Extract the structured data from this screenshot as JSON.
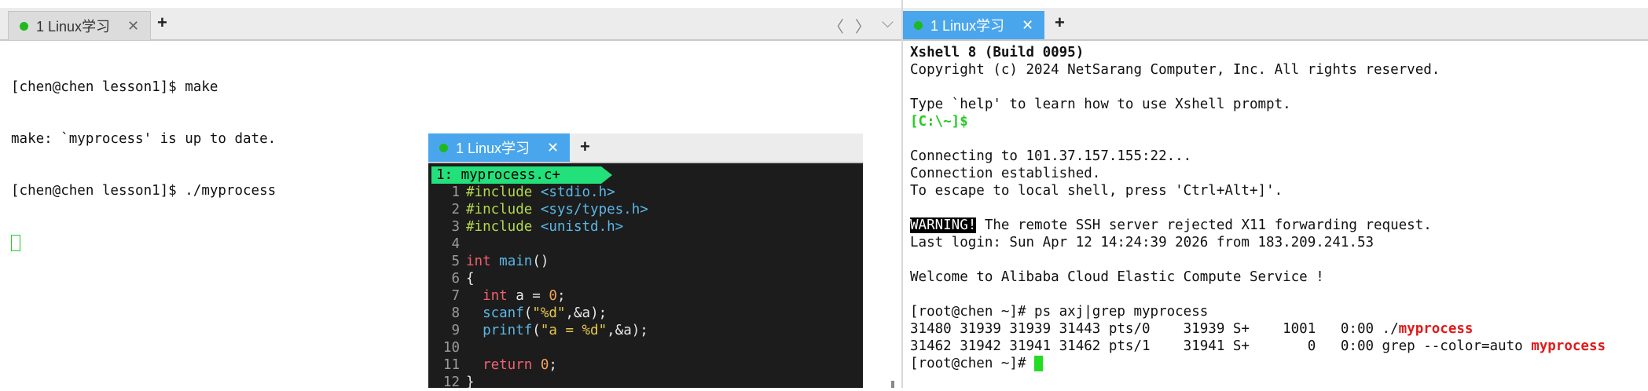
{
  "left": {
    "tab": {
      "label": "1 Linux学习",
      "close": "✕"
    },
    "plus": "+",
    "nav": {
      "prev": "〈",
      "next": "〉",
      "menu": "⌵"
    },
    "lines": [
      "[chen@chen lesson1]$ make",
      "make: `myprocess' is up to date.",
      "[chen@chen lesson1]$ ./myprocess"
    ]
  },
  "vim_window": {
    "tab": {
      "label": "1 Linux学习",
      "close": "✕"
    },
    "plus": "+",
    "buffer_title": "1: myprocess.c+",
    "code": [
      {
        "n": "1",
        "parts": [
          [
            "pp",
            "#include "
          ],
          [
            "inc",
            "<stdio.h>"
          ]
        ]
      },
      {
        "n": "2",
        "parts": [
          [
            "pp",
            "#include "
          ],
          [
            "inc",
            "<sys/types.h>"
          ]
        ]
      },
      {
        "n": "3",
        "parts": [
          [
            "pp",
            "#include "
          ],
          [
            "inc",
            "<unistd.h>"
          ]
        ]
      },
      {
        "n": "4",
        "parts": []
      },
      {
        "n": "5",
        "parts": [
          [
            "kw",
            "int "
          ],
          [
            "fn",
            "main"
          ],
          [
            "pl",
            "()"
          ]
        ]
      },
      {
        "n": "6",
        "parts": [
          [
            "pl",
            "{"
          ]
        ]
      },
      {
        "n": "7",
        "parts": [
          [
            "pl",
            "  "
          ],
          [
            "kw",
            "int "
          ],
          [
            "pl",
            "a = "
          ],
          [
            "num",
            "0"
          ],
          [
            "pl",
            ";"
          ]
        ]
      },
      {
        "n": "8",
        "parts": [
          [
            "pl",
            "  "
          ],
          [
            "fn",
            "scanf"
          ],
          [
            "pl",
            "("
          ],
          [
            "str",
            "\"%d\""
          ],
          [
            "pl",
            ",&a);"
          ]
        ]
      },
      {
        "n": "9",
        "parts": [
          [
            "pl",
            "  "
          ],
          [
            "fn",
            "printf"
          ],
          [
            "pl",
            "("
          ],
          [
            "str",
            "\"a = %d\""
          ],
          [
            "pl",
            ",&a);"
          ]
        ]
      },
      {
        "n": "10",
        "parts": []
      },
      {
        "n": "11",
        "parts": [
          [
            "pl",
            "  "
          ],
          [
            "kw",
            "return "
          ],
          [
            "num",
            "0"
          ],
          [
            "pl",
            ";"
          ]
        ]
      },
      {
        "n": "12",
        "parts": [
          [
            "pl",
            "}"
          ]
        ]
      }
    ]
  },
  "right": {
    "tab": {
      "label": "1 Linux学习",
      "close": "✕"
    },
    "plus": "+",
    "lines": [
      {
        "type": "bold",
        "text": "Xshell 8 (Build 0095)"
      },
      {
        "type": "plain",
        "text": "Copyright (c) 2024 NetSarang Computer, Inc. All rights reserved."
      },
      {
        "type": "plain",
        "text": ""
      },
      {
        "type": "plain",
        "text": "Type `help' to learn how to use Xshell prompt."
      },
      {
        "type": "green",
        "text": "[C:\\~]$"
      },
      {
        "type": "plain",
        "text": ""
      },
      {
        "type": "plain",
        "text": "Connecting to 101.37.157.155:22..."
      },
      {
        "type": "plain",
        "text": "Connection established."
      },
      {
        "type": "plain",
        "text": "To escape to local shell, press 'Ctrl+Alt+]'."
      },
      {
        "type": "plain",
        "text": ""
      },
      {
        "type": "warn",
        "label": "WARNING!",
        "text": " The remote SSH server rejected X11 forwarding request."
      },
      {
        "type": "plain",
        "text": "Last login: Sun Apr 12 14:24:39 2026 from 183.209.241.53"
      },
      {
        "type": "plain",
        "text": ""
      },
      {
        "type": "plain",
        "text": "Welcome to Alibaba Cloud Elastic Compute Service !"
      },
      {
        "type": "plain",
        "text": ""
      },
      {
        "type": "plain",
        "text": "[root@chen ~]# ps axj|grep myprocess"
      },
      {
        "type": "hl",
        "text": "31480 31939 31939 31443 pts/0    31939 S+    1001   0:00 ./",
        "hl": "myprocess"
      },
      {
        "type": "hl",
        "text": "31462 31942 31941 31462 pts/1    31941 S+       0   0:00 grep --color=auto ",
        "hl": "myprocess"
      },
      {
        "type": "prompt",
        "text": "[root@chen ~]# "
      }
    ]
  },
  "colors": {
    "tab_active": "#4aa6ec",
    "status_dot": "#1fb91f",
    "vim_bg": "#1c1c1c",
    "vim_title": "#22e07a",
    "cursor": "#22dd22",
    "highlight": "#e01b1b"
  }
}
